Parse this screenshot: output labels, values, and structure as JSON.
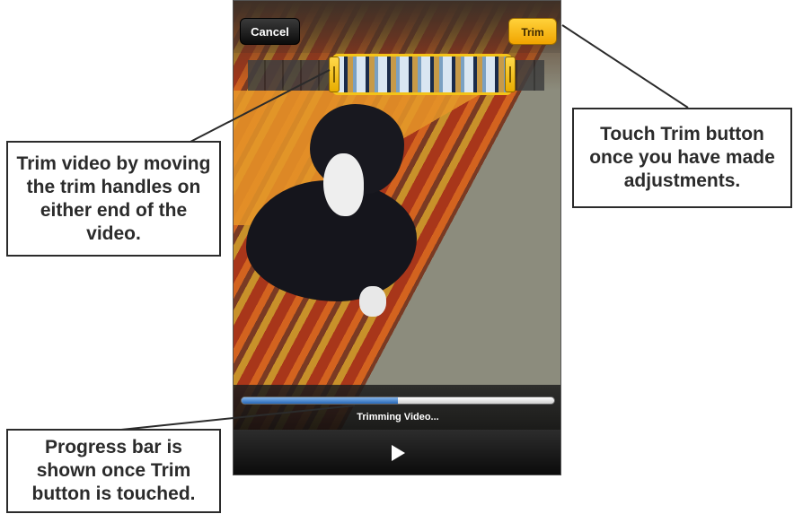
{
  "phone": {
    "cancel_label": "Cancel",
    "trim_label": "Trim",
    "progress_label": "Trimming Video...",
    "progress_fraction": 0.5
  },
  "callouts": {
    "trim_handles": "Trim video by moving the trim handles on either end of the video.",
    "trim_button": "Touch Trim button once you have made adjustments.",
    "progress": "Progress bar is shown once Trim button is touched."
  },
  "icons": {
    "play": "play-icon",
    "trim_handle": "trim-handle-icon"
  },
  "colors": {
    "trim_accent": "#f3c318",
    "progress_fill": "#2767b7"
  }
}
